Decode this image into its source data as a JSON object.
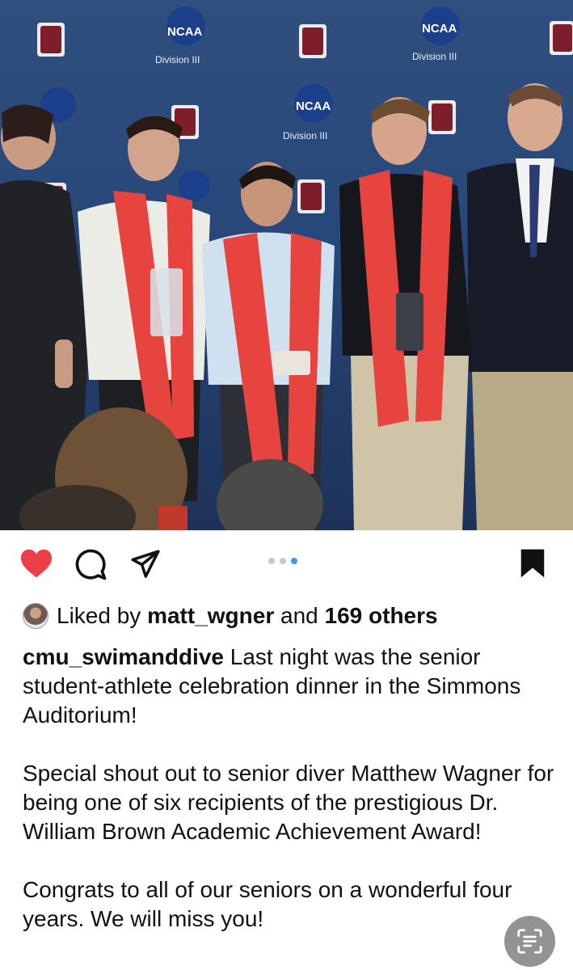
{
  "post": {
    "photo_banner": {
      "ncaa_text": "NCAA",
      "division_text": "Division III"
    },
    "carousel": {
      "total": 3,
      "active_index": 2
    },
    "likes": {
      "prefix": "Liked by ",
      "user": "matt_wgner",
      "middle": " and ",
      "others": "169 others"
    },
    "caption": {
      "username": "cmu_swimanddive",
      "paragraph1": "Last night was the senior student-athlete celebration dinner in the Simmons Auditorium!",
      "paragraph2": "Special shout out to senior diver Matthew Wagner for being one of six recipients of the prestigious Dr. William Brown Academic Achievement Award!",
      "paragraph3": "Congrats to all of our seniors on  a wonderful four years. We will miss you!"
    }
  },
  "colors": {
    "heart": "#ed3d48",
    "dot_active": "#3897f0",
    "stole": "#e8443f"
  },
  "icons": [
    "heart-icon",
    "comment-icon",
    "share-icon",
    "bookmark-icon",
    "text-scan-icon"
  ]
}
